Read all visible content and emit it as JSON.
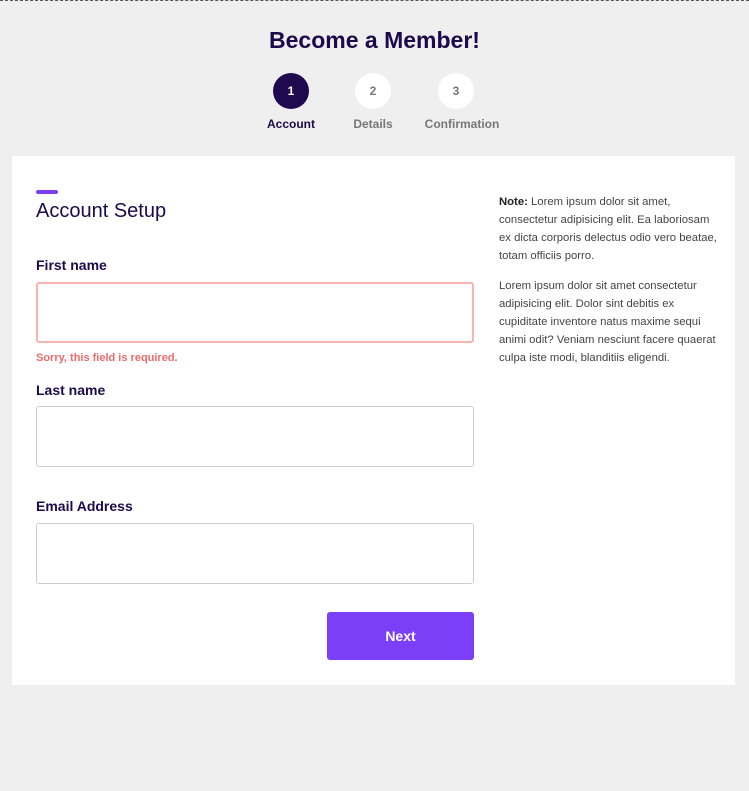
{
  "header": {
    "title": "Become a Member!"
  },
  "stepper": {
    "steps": [
      {
        "number": "1",
        "label": "Account",
        "active": true
      },
      {
        "number": "2",
        "label": "Details",
        "active": false
      },
      {
        "number": "3",
        "label": "Confirmation",
        "active": false
      }
    ]
  },
  "form": {
    "section_title": "Account Setup",
    "first_name": {
      "label": "First name",
      "value": "",
      "error": "Sorry, this field is required."
    },
    "last_name": {
      "label": "Last name",
      "value": ""
    },
    "email": {
      "label": "Email Address",
      "value": ""
    },
    "next_label": "Next"
  },
  "aside": {
    "note_label": "Note:",
    "note_text": " Lorem ipsum dolor sit amet, consectetur adipisicing elit. Ea laboriosam ex dicta corporis delectus odio vero beatae, totam officiis porro.",
    "paragraph": "Lorem ipsum dolor sit amet consectetur adipisicing elit. Dolor sint debitis ex cupiditate inventore natus maxime sequi animi odit? Veniam nesciunt facere quaerat culpa iste modi, blanditiis eligendi."
  },
  "colors": {
    "brand_dark": "#1d0a4b",
    "accent": "#7b3ff7",
    "error": "#ee6b6b",
    "error_border": "#f7b4b0",
    "background": "#efefef"
  }
}
